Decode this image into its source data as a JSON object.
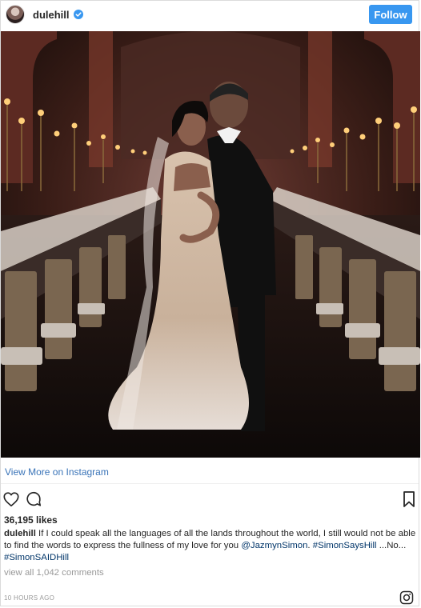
{
  "header": {
    "username": "dulehill",
    "follow_label": "Follow"
  },
  "view_more_label": "View More on Instagram",
  "likes": "36,195 likes",
  "caption": {
    "username": "dulehill",
    "text_1": " If I could speak all the languages of all the lands throughout the world, I still would not be able to find the words to express the fullness of my love for you ",
    "mention": "@JazmynSimon",
    "text_2": ". ",
    "hashtag_1": "#SimonSaysHill",
    "more": " ...No...",
    "hashtag_2": "#SimonSAIDHill"
  },
  "view_comments_label": "view all 1,042 comments",
  "timestamp": "10 HOURS AGO",
  "icons": [
    "heart-icon",
    "comment-icon",
    "bookmark-icon",
    "instagram-logo-icon",
    "verified-badge-icon"
  ],
  "colors": {
    "follow_button": "#3897f0",
    "link_blue": "#3a74b8",
    "muted_text": "#999999"
  }
}
